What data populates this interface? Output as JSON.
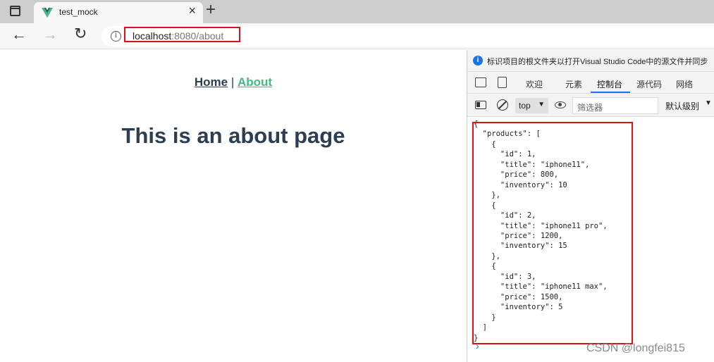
{
  "browser": {
    "tab_title": "test_mock",
    "url_host": "localhost",
    "url_rest": ":8080/about"
  },
  "page": {
    "nav_home": "Home",
    "nav_separator": " | ",
    "nav_about": "About",
    "heading": "This is an about page"
  },
  "devtools": {
    "info_text": "标识项目的根文件夹以打开Visual Studio Code中的源文件并同步",
    "tabs": [
      "欢迎",
      "元素",
      "控制台",
      "源代码",
      "网络"
    ],
    "active_tab": "控制台",
    "context": "top",
    "filter_placeholder": "筛选器",
    "levels": "默认级别",
    "console_output": "{\n  \"products\": [\n    {\n      \"id\": 1,\n      \"title\": \"iphone11\",\n      \"price\": 800,\n      \"inventory\": 10\n    },\n    {\n      \"id\": 2,\n      \"title\": \"iphone11 pro\",\n      \"price\": 1200,\n      \"inventory\": 15\n    },\n    {\n      \"id\": 3,\n      \"title\": \"iphone11 max\",\n      \"price\": 1500,\n      \"inventory\": 5\n    }\n  ]\n}",
    "prompt": "›"
  },
  "watermark": "CSDN @longfei815",
  "colors": {
    "vue_green": "#42b983",
    "vue_dark": "#2c3e50",
    "highlight_red": "#dd1111",
    "devtools_blue": "#1a73e8"
  },
  "icons": [
    "sidebar-toggle-icon",
    "vue-logo-icon",
    "close-icon",
    "plus-icon",
    "back-arrow-icon",
    "forward-arrow-icon",
    "reload-icon",
    "info-icon",
    "inspect-icon",
    "device-icon",
    "console-sidebar-icon",
    "clear-console-icon",
    "eye-icon"
  ]
}
